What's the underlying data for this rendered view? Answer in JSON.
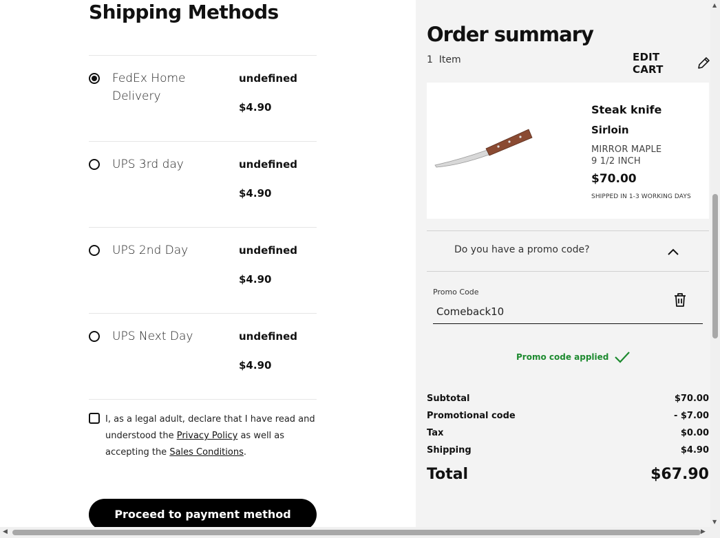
{
  "shipping": {
    "title": "Shipping Methods",
    "methods": [
      {
        "name": "FedEx Home Delivery",
        "eta": "undefined",
        "price": "$4.90",
        "selected": true
      },
      {
        "name": "UPS 3rd day",
        "eta": "undefined",
        "price": "$4.90",
        "selected": false
      },
      {
        "name": "UPS 2nd Day",
        "eta": "undefined",
        "price": "$4.90",
        "selected": false
      },
      {
        "name": "UPS Next Day",
        "eta": "undefined",
        "price": "$4.90",
        "selected": false
      }
    ]
  },
  "legal": {
    "text_before": "I, as a legal adult, declare that I have read and understood the ",
    "privacy_link": "Privacy Policy",
    "text_middle": " as well as accepting the ",
    "sales_link": "Sales Conditions",
    "text_after": "."
  },
  "proceed_button": "Proceed to payment method",
  "summary": {
    "title": "Order summary",
    "item_count": "1  Item",
    "edit_cart": "EDIT CART",
    "product": {
      "name": "Steak knife",
      "variant": "Sirloin",
      "finish": "MIRROR MAPLE",
      "size": "9 1/2 INCH",
      "price": "$70.00",
      "shipping_note": "SHIPPED IN 1-3 WORKING DAYS"
    },
    "promo_question": "Do you have a promo code?",
    "promo_label": "Promo Code",
    "promo_value": "Comeback10",
    "promo_applied": "Promo code applied",
    "totals": [
      {
        "label": "Subtotal",
        "value": "$70.00"
      },
      {
        "label": "Promotional code",
        "value": "- $7.00"
      },
      {
        "label": "Tax",
        "value": "$0.00"
      },
      {
        "label": "Shipping",
        "value": "$4.90"
      }
    ],
    "total_label": "Total",
    "total_value": "$67.90"
  },
  "colors": {
    "accent_green": "#1d8a2f",
    "summary_bg": "#f3f3f3",
    "button_bg": "#000000"
  }
}
